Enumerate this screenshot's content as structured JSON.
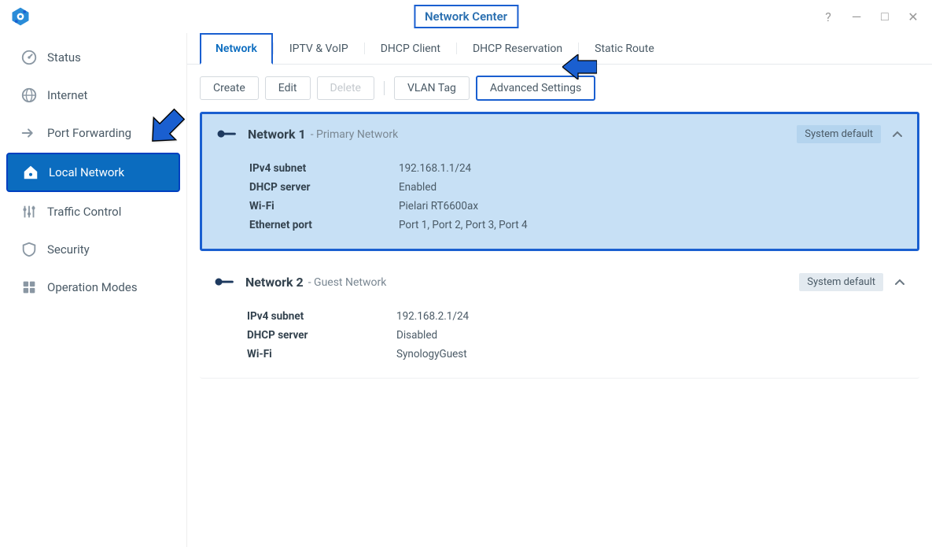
{
  "window": {
    "title": "Network Center"
  },
  "sidebar": {
    "items": [
      {
        "label": "Status"
      },
      {
        "label": "Internet"
      },
      {
        "label": "Port Forwarding"
      },
      {
        "label": "Local Network"
      },
      {
        "label": "Traffic Control"
      },
      {
        "label": "Security"
      },
      {
        "label": "Operation Modes"
      }
    ]
  },
  "tabs": {
    "items": [
      {
        "label": "Network"
      },
      {
        "label": "IPTV & VoIP"
      },
      {
        "label": "DHCP Client"
      },
      {
        "label": "DHCP Reservation"
      },
      {
        "label": "Static Route"
      }
    ]
  },
  "toolbar": {
    "create": "Create",
    "edit": "Edit",
    "delete": "Delete",
    "vlan": "VLAN Tag",
    "advanced": "Advanced Settings"
  },
  "networks": [
    {
      "name": "Network 1",
      "subtitle": "- Primary Network",
      "badge": "System default",
      "details": {
        "ipv4_label": "IPv4 subnet",
        "ipv4_value": "192.168.1.1/24",
        "dhcp_label": "DHCP server",
        "dhcp_value": "Enabled",
        "wifi_label": "Wi-Fi",
        "wifi_value": "Pielari RT6600ax",
        "port_label": "Ethernet port",
        "port_value": "Port 1, Port 2, Port 3, Port 4"
      }
    },
    {
      "name": "Network 2",
      "subtitle": "- Guest Network",
      "badge": "System default",
      "details": {
        "ipv4_label": "IPv4 subnet",
        "ipv4_value": "192.168.2.1/24",
        "dhcp_label": "DHCP server",
        "dhcp_value": "Disabled",
        "wifi_label": "Wi-Fi",
        "wifi_value": "SynologyGuest"
      }
    }
  ]
}
